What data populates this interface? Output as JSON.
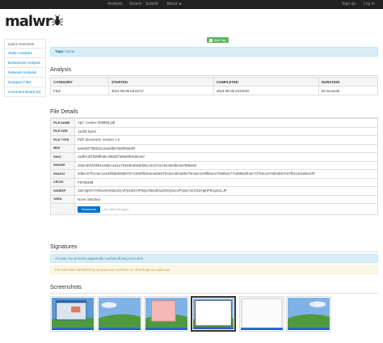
{
  "nav": {
    "items": [
      "Analysis",
      "Search",
      "Submit",
      "About"
    ],
    "signup": "Sign up",
    "login": "Log in"
  },
  "brand": {
    "logo_text": "malwr",
    "icon": "bug-icon"
  },
  "sidebar": {
    "items": [
      {
        "label": "Quick Overview"
      },
      {
        "label": "Static Analysis"
      },
      {
        "label": "Behavioral Analysis"
      },
      {
        "label": "Network Analysis"
      },
      {
        "label": "Dropped Files"
      },
      {
        "label": "Comment Board (0)"
      }
    ]
  },
  "tags": {
    "button_label": "Add Tag",
    "label": "Tags:",
    "value": "None"
  },
  "analysis": {
    "title": "Analysis",
    "columns": [
      "CATEGORY",
      "STARTED",
      "COMPLETED",
      "DURATION"
    ],
    "row": [
      "FILE",
      "2014-05-06 03:02:47",
      "2014-05-06 03:03:50",
      "63 seconds"
    ]
  },
  "file_details": {
    "title": "File Details",
    "rows": [
      {
        "label": "FILE NAME",
        "value": "Apr/. invoice 005959.pdf"
      },
      {
        "label": "FILE SIZE",
        "value": "11028 bytes"
      },
      {
        "label": "FILE TYPE",
        "value": "PDF document, version 1.5"
      },
      {
        "label": "MD5",
        "value": "aae0827f38011e2aa3fb07660f9da9f3"
      },
      {
        "label": "SHA1",
        "value": "cadfec3f1f285fbabc496dd7a90e8fcbd3eeef"
      },
      {
        "label": "SHA256",
        "value": "28324bf1f2f0b1e46bcce61a79318640946f25cc413741e913a0dbe3a7696460"
      },
      {
        "label": "SHA512",
        "value": "2dbe1b7fce4ec1e2d3f8ab936b076711830fbdeaea03e97b43ce491a6b07fe2a2c1e9fbbeee7549b41771d88ad2b4e7cf7b3ca47e6b4b67e37fb413cbe8e43f7"
      },
      {
        "label": "CRC32",
        "value": "F9783488"
      },
      {
        "label": "SSDEEP",
        "value": "192:9gVmYHWxvmnX6ZJGyVPpLWCHF6Qv/46tx3htuZhGQnw:UP/Q3xYorXGZHgHF9GgUJLJP"
      },
      {
        "label": "YARA",
        "value": "None matched"
      }
    ],
    "download_label": "Download",
    "login_note": "You need to login"
  },
  "signatures": {
    "title": "Signatures",
    "items": [
      {
        "text": "At least one process apparently crashed during execution",
        "type": "info"
      },
      {
        "text": "File has been identified by at least one AntiVirus on VirusTotal as malicious",
        "type": "warning"
      }
    ]
  },
  "screenshots": {
    "title": "Screenshots",
    "count": 6,
    "selected_index": 3
  }
}
